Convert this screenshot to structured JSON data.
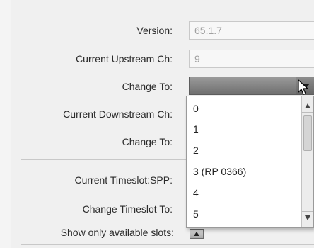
{
  "form": {
    "version_label": "Version:",
    "version_value": "65.1.7",
    "upstream_label": "Current Upstream Ch:",
    "upstream_value": "9",
    "change_to_label_1": "Change To:",
    "downstream_label": "Current Downstream Ch:",
    "change_to_label_2": "Change To:",
    "timeslot_label": "Current Timeslot:SPP:",
    "change_timeslot_label": "Change Timeslot To:",
    "show_slots_label": "Show only available slots:"
  },
  "dropdown": {
    "options": [
      "0",
      "1",
      "2",
      "3 (RP 0366)",
      "4",
      "5"
    ]
  },
  "icons": {
    "dropdown_arrow": "chevron-down-icon",
    "scroll_up": "scroll-up-arrow-icon",
    "scroll_down": "scroll-down-arrow-icon",
    "cursor": "mouse-pointer-icon"
  }
}
